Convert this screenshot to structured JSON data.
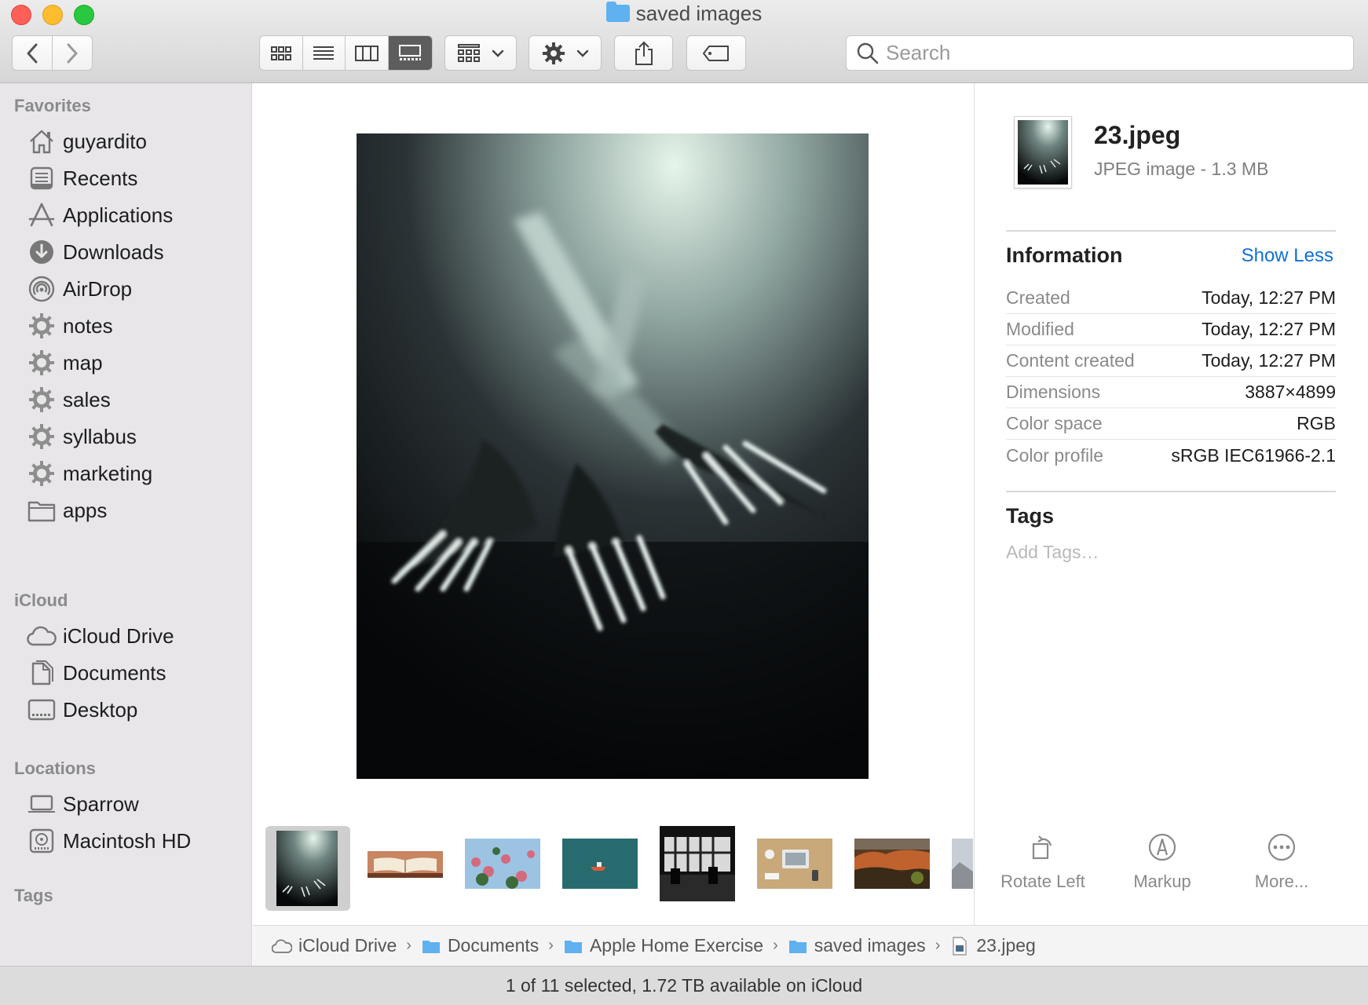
{
  "window": {
    "title": "saved images"
  },
  "toolbar": {
    "search_placeholder": "Search"
  },
  "sidebar": {
    "favorites_header": "Favorites",
    "favorites": [
      {
        "label": "guyardito",
        "icon": "home-icon"
      },
      {
        "label": "Recents",
        "icon": "recents-icon"
      },
      {
        "label": "Applications",
        "icon": "applications-icon"
      },
      {
        "label": "Downloads",
        "icon": "downloads-icon"
      },
      {
        "label": "AirDrop",
        "icon": "airdrop-icon"
      },
      {
        "label": "notes",
        "icon": "gear-folder-icon"
      },
      {
        "label": "map",
        "icon": "gear-folder-icon"
      },
      {
        "label": "sales",
        "icon": "gear-folder-icon"
      },
      {
        "label": "syllabus",
        "icon": "gear-folder-icon"
      },
      {
        "label": "marketing",
        "icon": "gear-folder-icon"
      },
      {
        "label": "apps",
        "icon": "folder-icon"
      }
    ],
    "icloud_header": "iCloud",
    "icloud": [
      {
        "label": "iCloud Drive",
        "icon": "cloud-icon"
      },
      {
        "label": "Documents",
        "icon": "documents-icon"
      },
      {
        "label": "Desktop",
        "icon": "desktop-icon"
      }
    ],
    "locations_header": "Locations",
    "locations": [
      {
        "label": "Sparrow",
        "icon": "laptop-icon"
      },
      {
        "label": "Macintosh HD",
        "icon": "harddrive-icon"
      }
    ],
    "tags_header": "Tags"
  },
  "inspector": {
    "file_name": "23.jpeg",
    "file_kind": "JPEG image - 1.3 MB",
    "information_title": "Information",
    "show_less": "Show Less",
    "rows": [
      {
        "key": "Created",
        "value": "Today, 12:27 PM"
      },
      {
        "key": "Modified",
        "value": "Today, 12:27 PM"
      },
      {
        "key": "Content created",
        "value": "Today, 12:27 PM"
      },
      {
        "key": "Dimensions",
        "value": "3887×4899"
      },
      {
        "key": "Color space",
        "value": "RGB"
      },
      {
        "key": "Color profile",
        "value": "sRGB IEC61966-2.1"
      }
    ],
    "tags_title": "Tags",
    "add_tags_placeholder": "Add Tags…",
    "actions": [
      {
        "label": "Rotate Left",
        "icon": "rotate-left-icon"
      },
      {
        "label": "Markup",
        "icon": "markup-icon"
      },
      {
        "label": "More...",
        "icon": "more-icon"
      }
    ]
  },
  "pathbar": [
    {
      "label": "iCloud Drive",
      "icon": "cloud-icon"
    },
    {
      "label": "Documents",
      "icon": "folder-icon"
    },
    {
      "label": "Apple Home Exercise",
      "icon": "folder-icon"
    },
    {
      "label": "saved images",
      "icon": "folder-icon"
    },
    {
      "label": "23.jpeg",
      "icon": "jpeg-file-icon"
    }
  ],
  "status": "1 of 11 selected, 1.72 TB available on iCloud",
  "colors": {
    "accent": "#1170d6",
    "sidebar_bg": "#e8e6e9",
    "folder_blue": "#5fb1f0"
  }
}
